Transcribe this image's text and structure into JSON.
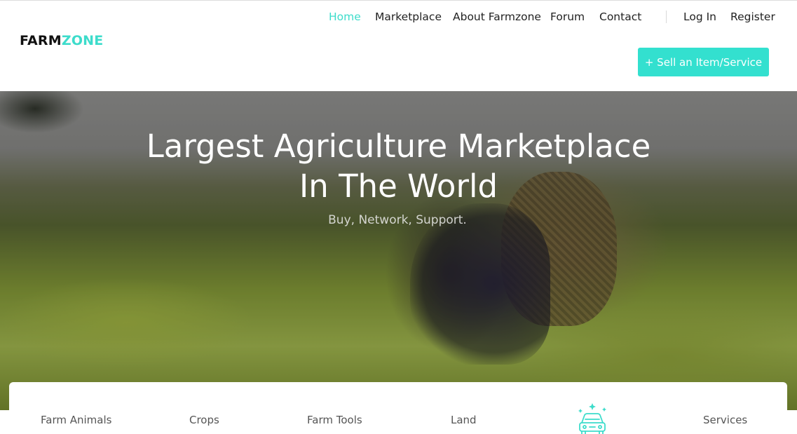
{
  "brand": {
    "part1": "FARM",
    "part2": "ZONE",
    "accent_color": "#3ddccb"
  },
  "nav": {
    "items": [
      {
        "label": "Home",
        "active": true
      },
      {
        "label": "Marketplace",
        "active": false
      },
      {
        "label": "About Farmzone",
        "active": false
      },
      {
        "label": "Forum",
        "active": false
      },
      {
        "label": "Contact",
        "active": false
      }
    ],
    "login": "Log In",
    "register": "Register"
  },
  "sell_button": {
    "label": "+ Sell an Item/Service",
    "color": "#33e0cf"
  },
  "hero": {
    "title_line1": "Largest Agriculture Marketplace",
    "title_line2": "In The World",
    "subtitle": "Buy, Network, Support."
  },
  "categories": {
    "items": [
      "Farm Animals",
      "Crops",
      "Farm Tools",
      "Land",
      "Services"
    ],
    "vehicles_icon": "car-icon"
  }
}
